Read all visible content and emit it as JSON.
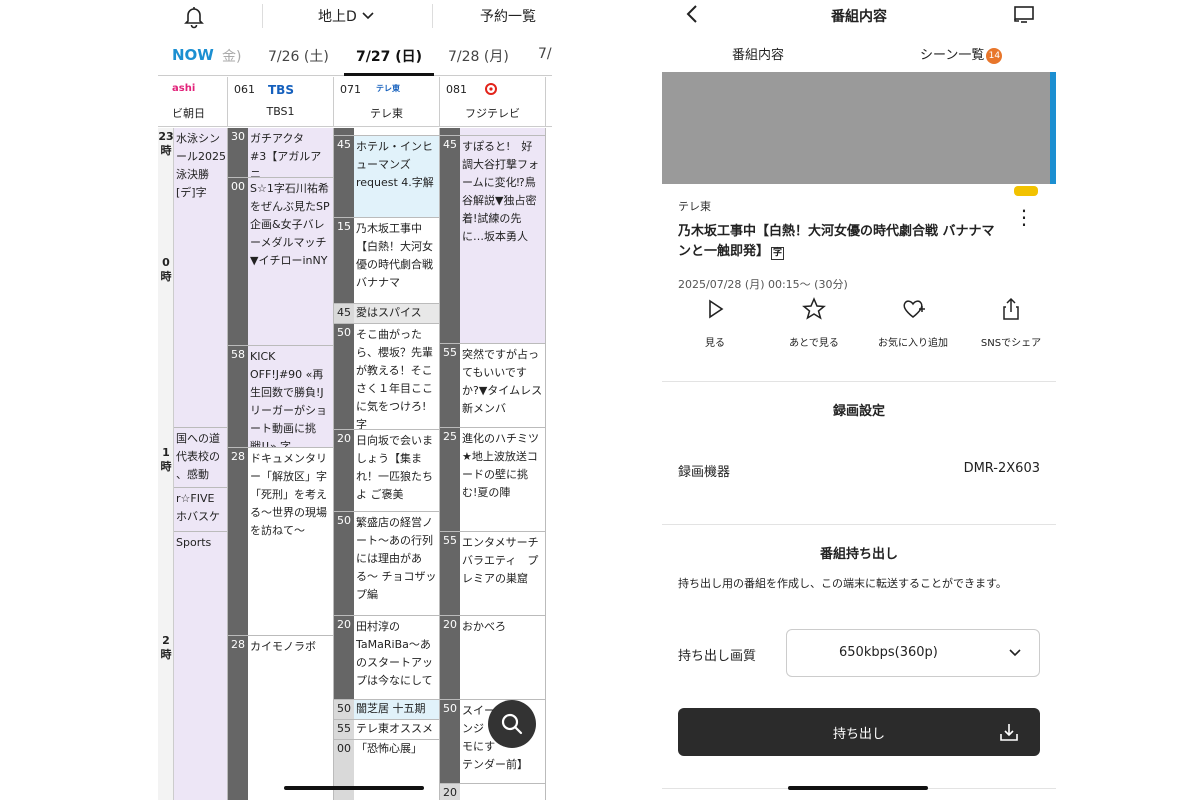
{
  "guide": {
    "area": "地上D",
    "reservations": "予約一覧",
    "dates": [
      "NOW",
      "金)",
      "7/26 (土)",
      "7/27 (日)",
      "7/28 (月)",
      "7/"
    ],
    "channels": [
      {
        "num": "",
        "logo": "ashi",
        "name": "ビ朝日"
      },
      {
        "num": "061",
        "logo": "TBS",
        "name": "TBS1"
      },
      {
        "num": "071",
        "logo": "テレ東",
        "name": "テレ東"
      },
      {
        "num": "081",
        "logo": "フジテレビ",
        "name": "フジテレビ"
      }
    ],
    "hours": [
      "23\n時",
      "0\n時",
      "1\n時",
      "2\n時"
    ],
    "col0": [
      "水泳シン\nール2025\n泳決勝\n[デ]字",
      "国への道\n代表校の\n、感動",
      "r☆FIVE\nホバスケ",
      "Sports"
    ],
    "col1": [
      {
        "min": "30",
        "title": "ガチアクタ　#3【アガルアニ"
      },
      {
        "min": "00",
        "title": "S☆1字石川祐希をぜんぶ見たSP企画&女子バレーメダルマッチ▼イチローinNY"
      },
      {
        "min": "58",
        "title": "KICK OFF!J#90 «再生回数で勝負!Jリーガーがショート動画に挑戦!!» 字"
      },
      {
        "min": "28",
        "title": "ドキュメンタリー「解放区」字「死刑」を考える〜世界の現場を訪ねて〜"
      },
      {
        "min": "28",
        "title": "カイモノラボ"
      }
    ],
    "col2": [
      {
        "min": "45",
        "title": "ホテル・インヒューマンズ request 4.字解"
      },
      {
        "min": "15",
        "title": "乃木坂工事中【白熱！大河女優の時代劇合戦 バナナマ"
      },
      {
        "min": "45",
        "title": "愛はスパイス"
      },
      {
        "min": "50",
        "title": "そこ曲がったら、櫻坂？先輩が教える！そこさく１年目ここに気をつけろ!字"
      },
      {
        "min": "20",
        "title": "日向坂で会いましょう【集まれ！一匹狼たちよ ご褒美"
      },
      {
        "min": "50",
        "title": "繁盛店の経営ノート〜あの行列には理由がある〜 チョコザップ編"
      },
      {
        "min": "20",
        "title": "田村淳のTaMaRiBa〜あのスタートアップは今なにして"
      },
      {
        "min": "50",
        "title": "闇芝居 十五期"
      },
      {
        "min": "55",
        "title": "テレ東オススメ"
      },
      {
        "min": "00",
        "title": "「恐怖心展」"
      }
    ],
    "col3": [
      {
        "min": "45",
        "title": "すぽると!　好調大谷打撃フォームに変化⁉鳥谷解説▼独占密着!試練の先に…坂本勇人"
      },
      {
        "min": "55",
        "title": "突然ですが占ってもいいですか?▼タイムレス新メンバ"
      },
      {
        "min": "25",
        "title": "進化のハチミツ★地上波放送コードの壁に挑む!夏の陣"
      },
      {
        "min": "55",
        "title": "エンタメサーチバラエティ　プレミアの巣窟"
      },
      {
        "min": "20",
        "title": "おかべろ"
      },
      {
        "min": "50",
        "title": "スイーツ\nンジ\nモにす\nテンダー前】"
      },
      {
        "min": "20",
        "title": ""
      }
    ]
  },
  "detail": {
    "title": "番組内容",
    "tabs": {
      "info": "番組内容",
      "scenes": "シーン一覧",
      "scene_count": "14"
    },
    "channel": "テレ東",
    "program_title": "乃木坂工事中【白熱！大河女優の時代劇合戦 バナナマンと一触即発】",
    "subtitle_mark": "字",
    "airtime": "2025/07/28 (月) 00:15～ (30分)",
    "actions": [
      {
        "icon": "play-icon",
        "label": "見る"
      },
      {
        "icon": "star-icon",
        "label": "あとで見る"
      },
      {
        "icon": "heart-plus-icon",
        "label": "お気に入り追加"
      },
      {
        "icon": "share-icon",
        "label": "SNSでシェア"
      }
    ],
    "recording": {
      "heading": "録画設定",
      "device_label": "録画機器",
      "device_value": "DMR-2X603"
    },
    "export": {
      "heading": "番組持ち出し",
      "description": "持ち出し用の番組を作成し、この端末に転送することができます。",
      "quality_label": "持ち出し画質",
      "quality_value": "650kbps(360p)",
      "button_label": "持ち出し"
    }
  }
}
